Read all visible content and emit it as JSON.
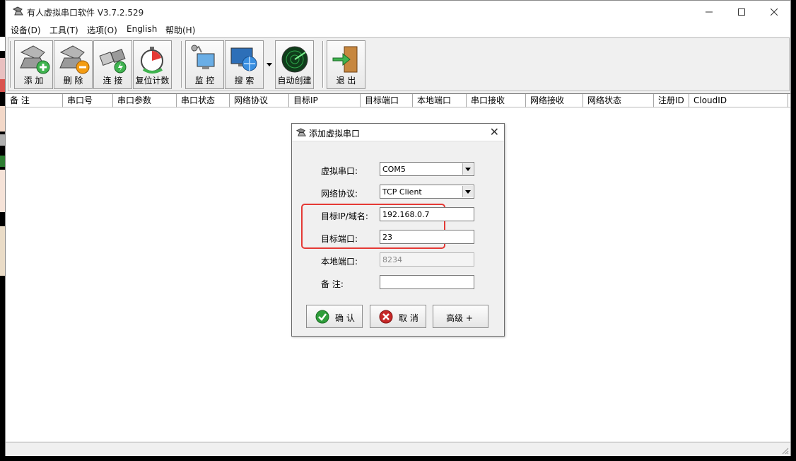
{
  "app": {
    "title": "有人虚拟串口软件 V3.7.2.529"
  },
  "menu": [
    "设备(D)",
    "工具(T)",
    "选项(O)",
    "English",
    "帮助(H)"
  ],
  "toolbar": {
    "add": "添 加",
    "delete": "删 除",
    "connect": "连 接",
    "reset_count": "复位计数",
    "monitor": "监 控",
    "search": "搜 索",
    "auto_create": "自动创建",
    "exit": "退 出"
  },
  "columns": [
    "备 注",
    "串口号",
    "串口参数",
    "串口状态",
    "网络协议",
    "目标IP",
    "目标端口",
    "本地端口",
    "串口接收",
    "网络接收",
    "网络状态",
    "注册ID",
    "CloudID"
  ],
  "dialog": {
    "title": "添加虚拟串口",
    "fields": {
      "virtual_port": {
        "label": "虚拟串口:",
        "value": "COM5"
      },
      "protocol": {
        "label": "网络协议:",
        "value": "TCP Client"
      },
      "target_ip": {
        "label": "目标IP/域名:",
        "value": "192.168.0.7"
      },
      "target_port": {
        "label": "目标端口:",
        "value": "23"
      },
      "local_port": {
        "label": "本地端口:",
        "value": "8234"
      },
      "remark": {
        "label": "备 注:",
        "value": ""
      }
    },
    "buttons": {
      "ok": "确 认",
      "cancel": "取 消",
      "advanced": "高级 +"
    }
  },
  "colors": {
    "highlight": "#e53935",
    "ok_icon": "#2e9d3a",
    "cancel_icon": "#c62828"
  }
}
